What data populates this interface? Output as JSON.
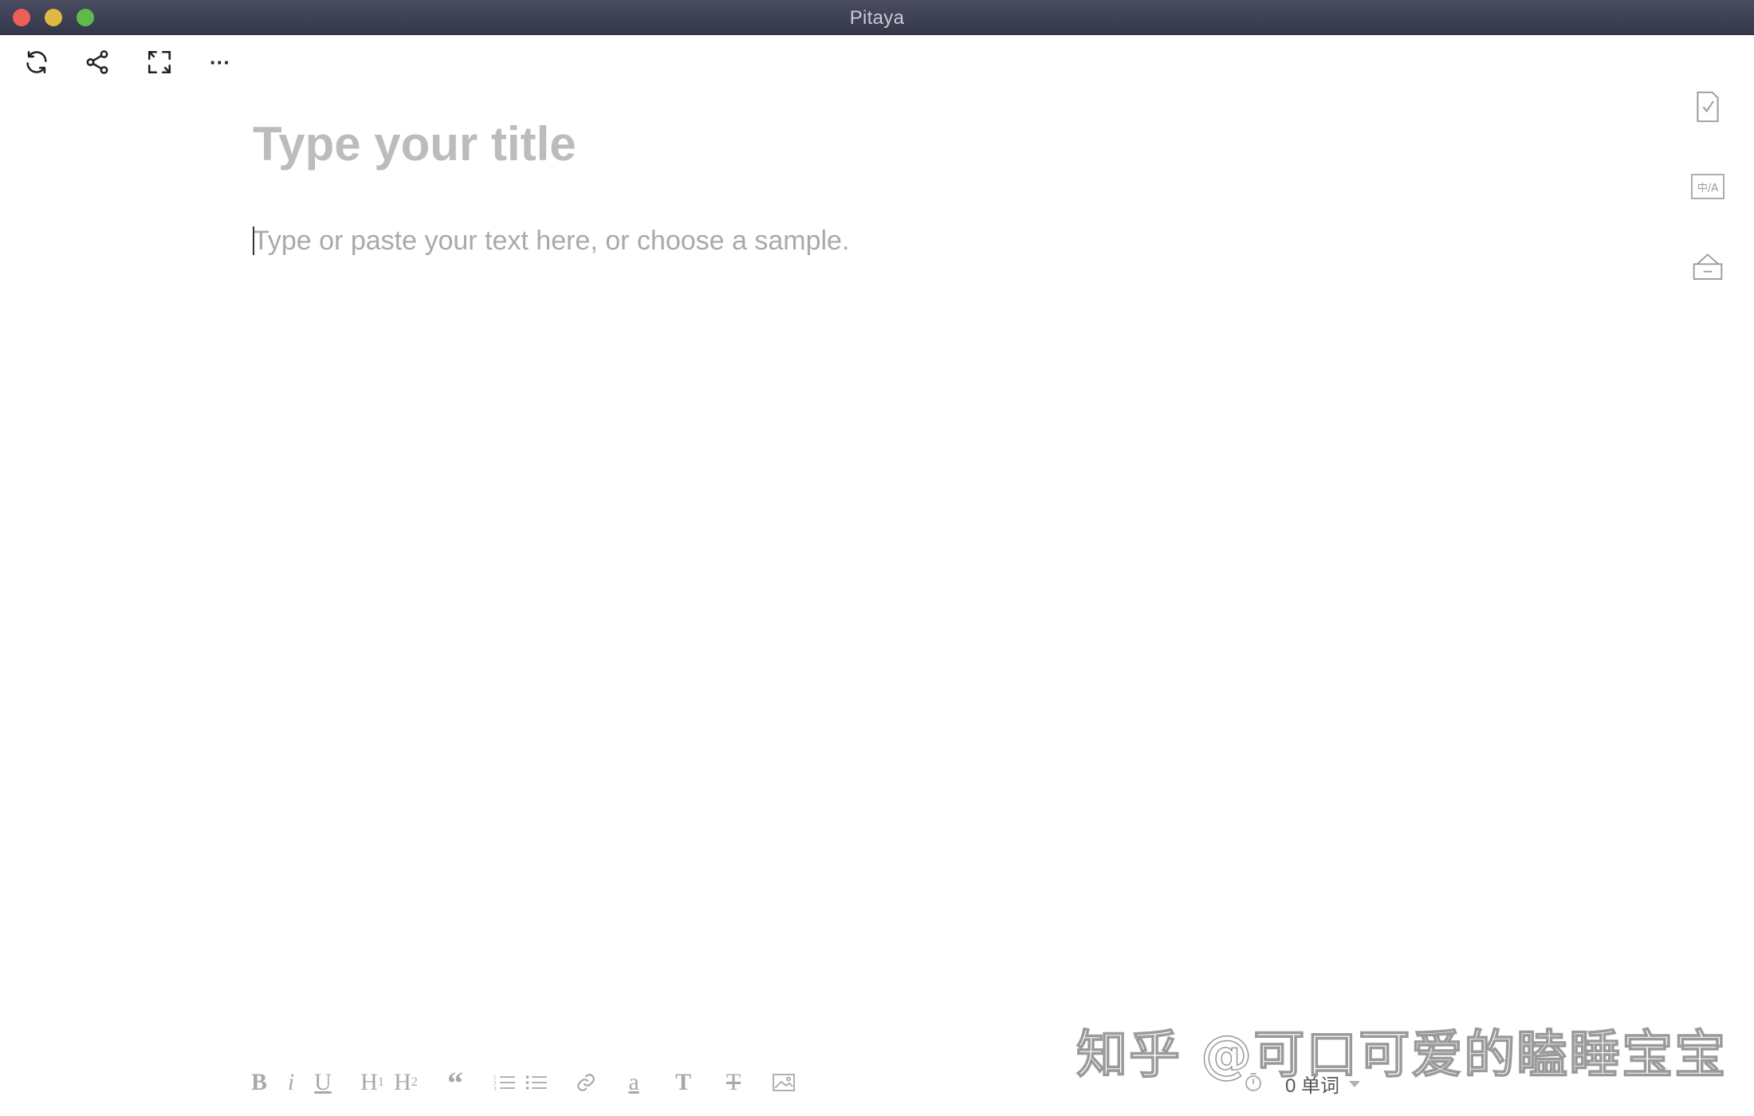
{
  "window": {
    "title": "Pitaya"
  },
  "toolbar": {
    "icons": [
      "refresh-icon",
      "share-icon",
      "fullscreen-icon",
      "more-icon"
    ],
    "more_label": "···"
  },
  "editor": {
    "title_placeholder": "Type your title",
    "body_placeholder": "Type or paste your text here, or choose a sample."
  },
  "side_panel": {
    "icons": [
      "document-check-icon",
      "translate-icon",
      "archive-box-icon"
    ],
    "translate_label": "中/A"
  },
  "format_bar": {
    "bold": "B",
    "italic": "i",
    "underline": "U",
    "h1": "H",
    "h1_sub": "1",
    "h2": "H",
    "h2_sub": "2",
    "quote": "“",
    "text_color": "a",
    "text_size": "T",
    "clear_format": "T"
  },
  "status": {
    "word_count": "0 单词"
  },
  "watermark": "知乎 @可口可爱的瞌睡宝宝"
}
